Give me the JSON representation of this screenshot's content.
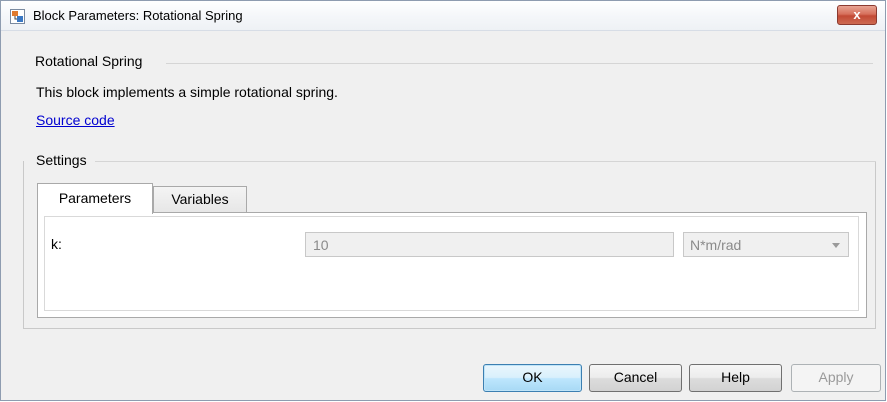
{
  "window": {
    "title": "Block Parameters: Rotational Spring",
    "close_glyph": "x"
  },
  "description_group": {
    "title": "Rotational Spring",
    "text": "This block implements a simple rotational spring.",
    "link": "Source code"
  },
  "settings": {
    "title": "Settings",
    "tabs": [
      {
        "label": "Parameters",
        "active": true
      },
      {
        "label": "Variables",
        "active": false
      }
    ],
    "parameters": [
      {
        "label": "k:",
        "value": "10",
        "unit": "N*m/rad"
      }
    ]
  },
  "buttons": {
    "ok": "OK",
    "cancel": "Cancel",
    "help": "Help",
    "apply": "Apply"
  },
  "icons": {
    "app": "simulink-block-icon",
    "close": "close-icon",
    "dropdown": "chevron-down-icon"
  },
  "colors": {
    "link": "#0000d0",
    "close_button": "#c24a35",
    "default_button_border": "#3c7fb1"
  }
}
